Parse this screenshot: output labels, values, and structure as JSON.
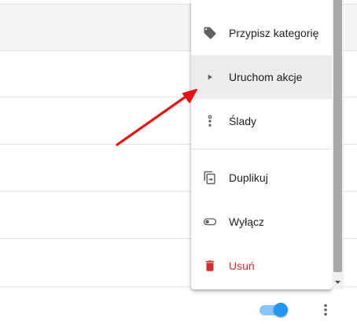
{
  "menu": {
    "items": [
      {
        "label": "Przypisz kategorię",
        "icon": "tag-icon"
      },
      {
        "label": "Uruchom akcje",
        "icon": "play-icon"
      },
      {
        "label": "Ślady",
        "icon": "traces-icon"
      },
      {
        "label": "Duplikuj",
        "icon": "duplicate-icon"
      },
      {
        "label": "Wyłącz",
        "icon": "toggle-off-icon"
      },
      {
        "label": "Usuń",
        "icon": "trash-icon"
      }
    ],
    "active_item": "Uruchom akcje"
  },
  "footer": {
    "toggle_on": true
  },
  "colors": {
    "accent": "#2196f3",
    "danger": "#d32f2f",
    "icon": "#616161",
    "annotation_arrow": "#e81010"
  }
}
